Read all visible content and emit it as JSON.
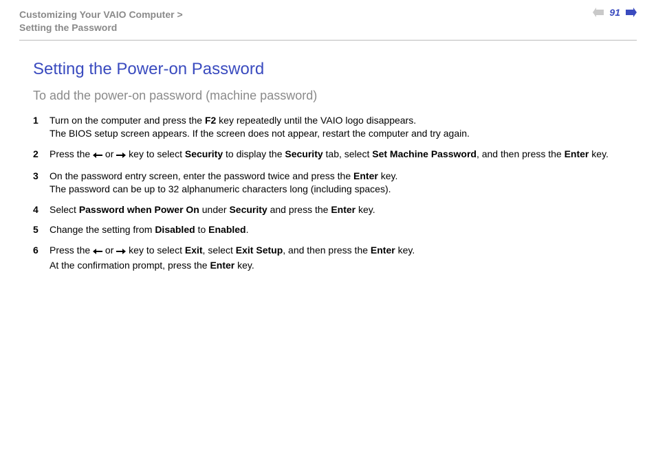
{
  "header": {
    "breadcrumb_line1": "Customizing Your VAIO Computer >",
    "breadcrumb_line2": "Setting the Password",
    "page_number": "91"
  },
  "title": "Setting the Power-on Password",
  "subtitle": "To add the power-on password (machine password)",
  "steps": [
    {
      "num": "1",
      "html": "Turn on the computer and press the <b>F2</b> key repeatedly until the VAIO logo disappears.<br>The BIOS setup screen appears. If the screen does not appear, restart the computer and try again."
    },
    {
      "num": "2",
      "html": "Press the {LEFT} or {RIGHT} key to select <b>Security</b> to display the <b>Security</b> tab, select <b>Set Machine Password</b>, and then press the <b>Enter</b> key."
    },
    {
      "num": "3",
      "html": "On the password entry screen, enter the password twice and press the <b>Enter</b> key.<br>The password can be up to 32 alphanumeric characters long (including spaces)."
    },
    {
      "num": "4",
      "html": "Select <b>Password when Power On</b> under <b>Security</b> and press the <b>Enter</b> key."
    },
    {
      "num": "5",
      "html": "Change the setting from <b>Disabled</b> to <b>Enabled</b>."
    },
    {
      "num": "6",
      "html": "Press the {LEFT} or {RIGHT} key to select <b>Exit</b>, select <b>Exit Setup</b>, and then press the <b>Enter</b> key.<br>At the confirmation prompt, press the <b>Enter</b> key."
    }
  ]
}
